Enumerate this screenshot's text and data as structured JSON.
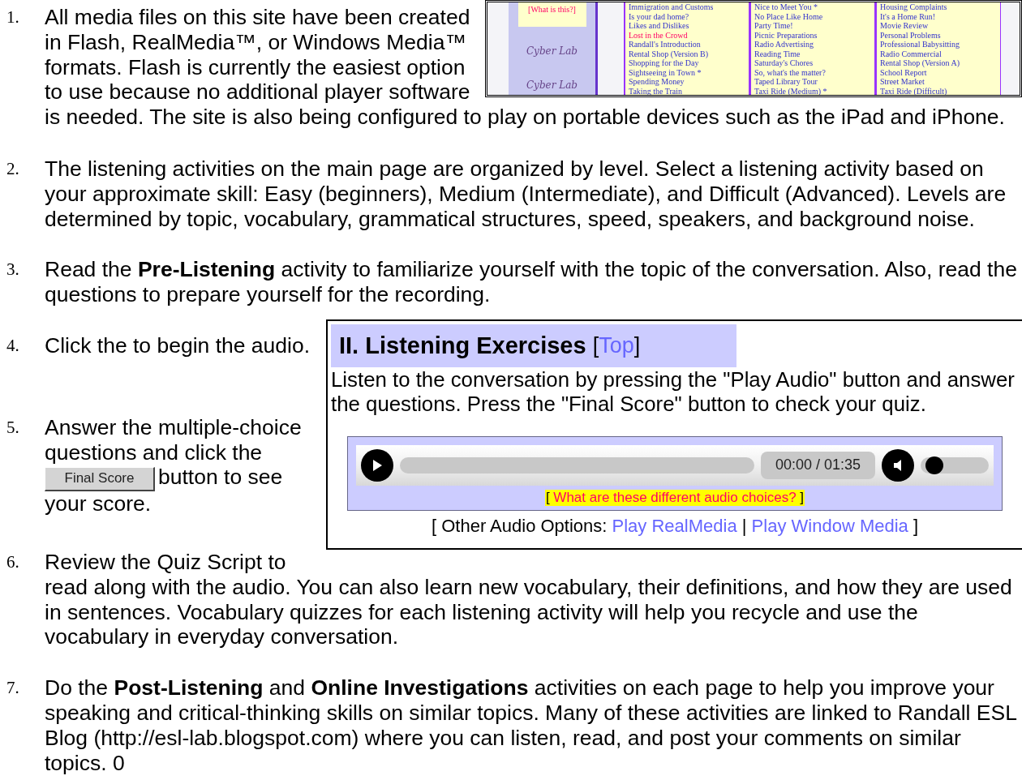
{
  "bracket_open": "[",
  "bracket_close": "]",
  "steps": [
    {
      "number": "1.",
      "text": "All media files on this site have been created in Flash, RealMedia™, or Windows Media™ formats. Flash is currently the easiest option to use because no additional player software",
      "text_continued": "is needed. The site is also being configured to play on portable devices such as the iPad and iPhone.",
      "site_inset": {
        "help_link": "[What is this?]",
        "logo_texts": [
          "Cyber Lab",
          "Cyber Lab"
        ],
        "columns": [
          [
            {
              "title": "Immigration and Customs",
              "highlighted": false
            },
            {
              "title": "Is your dad home?",
              "highlighted": false
            },
            {
              "title": "Likes and Dislikes",
              "highlighted": false
            },
            {
              "title": "Lost in the Crowd",
              "highlighted": true
            },
            {
              "title": "Randall's Introduction",
              "highlighted": false
            },
            {
              "title": "Rental Shop (Version B)",
              "highlighted": false
            },
            {
              "title": "Shopping for the Day",
              "highlighted": false
            },
            {
              "title": "Sightseeing in Town *",
              "highlighted": false
            },
            {
              "title": "Spending Money",
              "highlighted": false
            },
            {
              "title": "Taking the Train",
              "highlighted": false
            }
          ],
          [
            {
              "title": "Nice to Meet You *",
              "highlighted": false
            },
            {
              "title": "No Place Like Home",
              "highlighted": false
            },
            {
              "title": "Party Time!",
              "highlighted": false
            },
            {
              "title": "Picnic Preparations",
              "highlighted": false
            },
            {
              "title": "Radio Advertising",
              "highlighted": false
            },
            {
              "title": "Reading Time",
              "highlighted": false
            },
            {
              "title": "Saturday's Chores",
              "highlighted": false
            },
            {
              "title": "So, what's the matter?",
              "highlighted": false
            },
            {
              "title": "Taped Library Tour",
              "highlighted": false
            },
            {
              "title": "Taxi Ride (Medium) *",
              "highlighted": false
            }
          ],
          [
            {
              "title": "Housing Complaints",
              "highlighted": false
            },
            {
              "title": "It's a Home Run!",
              "highlighted": false
            },
            {
              "title": "Movie Review",
              "highlighted": false
            },
            {
              "title": "Personal Problems",
              "highlighted": false
            },
            {
              "title": "Professional Babysitting",
              "highlighted": false
            },
            {
              "title": "Radio Commercial",
              "highlighted": false
            },
            {
              "title": "Rental Shop (Version A)",
              "highlighted": false
            },
            {
              "title": "School Report",
              "highlighted": false
            },
            {
              "title": "Street Market",
              "highlighted": false
            },
            {
              "title": "Taxi Ride (Difficult)",
              "highlighted": false
            }
          ]
        ]
      }
    },
    {
      "number": "2.",
      "text": "The listening activities on the main page are organized by level. Select a listening activity based on your approximate skill: Easy (beginners), Medium (Intermediate), and Difficult (Advanced). Levels are determined by topic, vocabulary, grammatical structures, speed, speakers, and background noise."
    },
    {
      "number": "3.",
      "text": "Read the **Pre-Listening** activity to familiarize yourself with the topic of the conversation. Also, read the questions to prepare yourself for the recording."
    },
    {
      "number": "4.",
      "text": "Click the to begin the audio.",
      "exercises_panel": {
        "heading": "II. Listening Exercises",
        "top_link": "Top",
        "intro": "Listen to the conversation by pressing the \"Play Audio\" button and answer the questions. Press the \"Final Score\" button to check your quiz.",
        "player": {
          "progress": {
            "level": 0
          },
          "time": "00:00 / 01:35",
          "volume": {
            "level": 0.1
          }
        },
        "help_note": "What are these different audio choices?",
        "options_label": "Other Audio Options:",
        "option_links": [
          "Play RealMedia",
          "Play Window Media"
        ],
        "separator": "|"
      }
    },
    {
      "number": "5.",
      "text": "Answer the multiple-choice questions and click the",
      "button": "Final Score",
      "text_after": "button to see your score."
    },
    {
      "number": "6.",
      "text": "Review the Quiz Script to\nread along with the audio. You can also learn new vocabulary, their definitions, and how they are used in sentences. Vocabulary quizzes for each listening activity will help you recycle and use the vocabulary in everyday conversation."
    },
    {
      "number": "7.",
      "text": "Do the **Post-Listening** and **Online Investigations** activities on each page to help you improve your speaking and critical-thinking skills on similar topics. Many of these activities are linked to Randall ESL Blog (http://esl-lab.blogspot.com) where you can listen, read, and post your comments on similar topics. 0"
    }
  ]
}
